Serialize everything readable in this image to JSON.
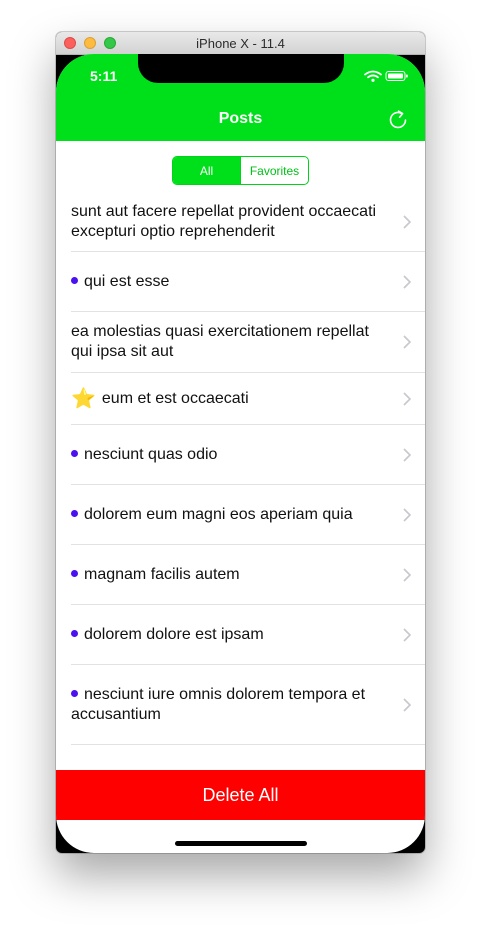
{
  "window": {
    "title": "iPhone X - 11.4"
  },
  "status_bar": {
    "time": "5:11",
    "icons": [
      "wifi-icon",
      "battery-icon"
    ]
  },
  "nav": {
    "title": "Posts",
    "right_icon": "refresh-icon"
  },
  "segment": {
    "options": [
      "All",
      "Favorites"
    ],
    "selected": "All"
  },
  "posts": [
    {
      "title": "sunt aut facere repellat provident occaecati excepturi optio reprehenderit",
      "marker": "none"
    },
    {
      "title": "qui est esse",
      "marker": "dot"
    },
    {
      "title": "ea molestias quasi exercitationem repellat qui ipsa sit aut",
      "marker": "none"
    },
    {
      "title": "eum et est occaecati",
      "marker": "star"
    },
    {
      "title": "nesciunt quas odio",
      "marker": "dot"
    },
    {
      "title": "dolorem eum magni eos aperiam quia",
      "marker": "dot"
    },
    {
      "title": "magnam facilis autem",
      "marker": "dot"
    },
    {
      "title": "dolorem dolore est ipsam",
      "marker": "dot"
    },
    {
      "title": "nesciunt iure omnis dolorem tempora et accusantium",
      "marker": "dot"
    }
  ],
  "footer": {
    "delete_label": "Delete All"
  },
  "colors": {
    "nav_green": "#00e01a",
    "unread_dot": "#4a10f0",
    "delete_red": "#ff0000"
  }
}
